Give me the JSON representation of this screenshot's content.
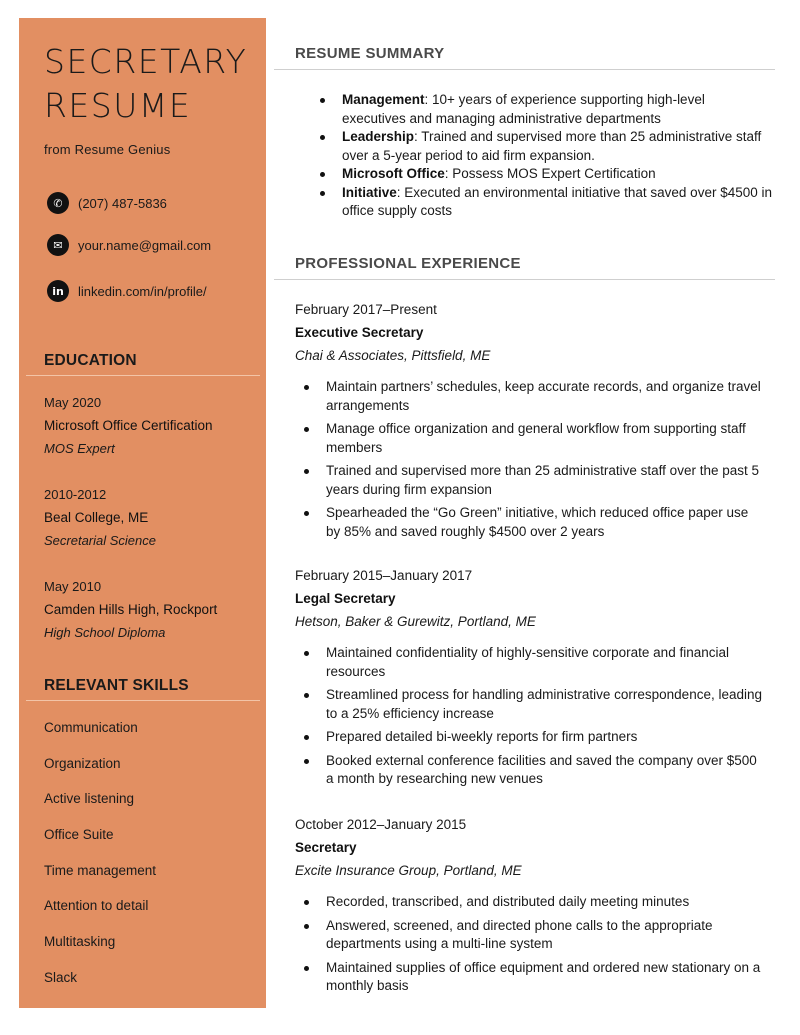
{
  "sidebar": {
    "title_line1": "SECRETARY",
    "title_line2": "RESUME",
    "subtitle": "from Resume Genius",
    "contacts": [
      {
        "icon": "phone-icon",
        "glyph": "✆",
        "text": "(207) 487-5836"
      },
      {
        "icon": "email-icon",
        "glyph": "✉",
        "text": "your.name@gmail.com"
      },
      {
        "icon": "linkedin-icon",
        "glyph": "in",
        "text": "linkedin.com/in/profile/"
      }
    ],
    "education_heading": "EDUCATION",
    "education": [
      {
        "date": "May 2020",
        "name": "Microsoft Office Certification",
        "field": "MOS Expert"
      },
      {
        "date": "2010-2012",
        "name": "Beal College, ME",
        "field": "Secretarial Science"
      },
      {
        "date": "May 2010",
        "name": "Camden Hills High, Rockport",
        "field": "High School Diploma"
      }
    ],
    "skills_heading": "RELEVANT SKILLS",
    "skills": [
      "Communication",
      "Organization",
      "Active listening",
      "Office Suite",
      "Time management",
      "Attention to detail",
      "Multitasking",
      "Slack"
    ]
  },
  "main": {
    "summary_heading": "RESUME SUMMARY",
    "summary": [
      {
        "label": "Management",
        "text": ": 10+ years of experience supporting high-level executives and managing administrative departments"
      },
      {
        "label": "Leadership",
        "text": ": Trained and supervised more than 25 administrative staff over a 5-year period to aid firm expansion."
      },
      {
        "label": "Microsoft Office",
        "text": ": Possess MOS Expert Certification"
      },
      {
        "label": "Initiative",
        "text": ": Executed an environmental initiative that saved over $4500 in office supply costs"
      }
    ],
    "experience_heading": "PROFESSIONAL EXPERIENCE",
    "jobs": [
      {
        "date": "February 2017–Present",
        "title": "Executive Secretary",
        "company": "Chai & Associates, Pittsfield, ME",
        "bullets": [
          "Maintain partners’ schedules, keep accurate records, and organize travel arrangements",
          "Manage office organization and general workflow from supporting staff members",
          "Trained and supervised more than 25 administrative staff over the past 5 years during firm expansion",
          "Spearheaded the “Go Green” initiative, which reduced office paper use by 85% and saved roughly $4500 over 2 years"
        ]
      },
      {
        "date": "February 2015–January 2017",
        "title": "Legal Secretary",
        "company": "Hetson, Baker & Gurewitz, Portland, ME",
        "bullets": [
          "Maintained confidentiality of highly-sensitive corporate and financial resources",
          "Streamlined process for handling administrative correspondence, leading to a 25% efficiency increase",
          "Prepared detailed bi-weekly reports for firm partners",
          "Booked external conference facilities and saved the company over $500 a month by researching new venues"
        ]
      },
      {
        "date": "October 2012–January 2015",
        "title": "Secretary",
        "company": "Excite Insurance Group, Portland, ME",
        "bullets": [
          "Recorded, transcribed, and distributed daily meeting minutes",
          "Answered, screened, and directed phone calls to the appropriate departments using a multi-line system",
          "Maintained supplies of office equipment and ordered new stationary on a monthly basis"
        ]
      }
    ]
  },
  "colors": {
    "sidebar_bg": "#e28f62",
    "heading_gray": "#4a4a4a",
    "text": "#1a1a1a"
  }
}
